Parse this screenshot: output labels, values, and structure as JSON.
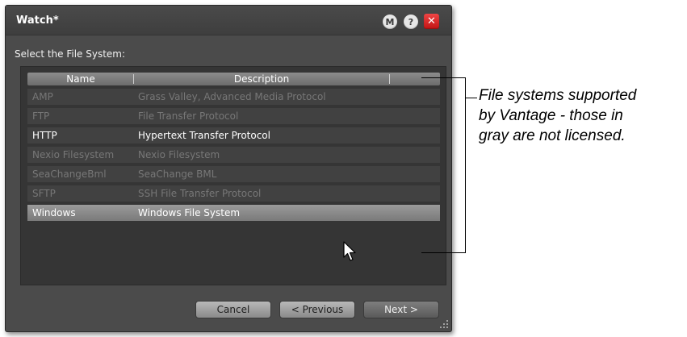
{
  "dialog": {
    "title": "Watch*",
    "buttons": {
      "m": "M",
      "help": "?",
      "close": "✕"
    },
    "prompt": "Select the File System:",
    "columns": {
      "name": "Name",
      "description": "Description"
    },
    "rows": [
      {
        "name": "AMP",
        "description": "Grass Valley, Advanced Media Protocol",
        "licensed": false
      },
      {
        "name": "FTP",
        "description": "File Transfer Protocol",
        "licensed": false
      },
      {
        "name": "HTTP",
        "description": "Hypertext Transfer Protocol",
        "licensed": true
      },
      {
        "name": "Nexio Filesystem",
        "description": "Nexio Filesystem",
        "licensed": false
      },
      {
        "name": "SeaChangeBml",
        "description": "SeaChange BML",
        "licensed": false
      },
      {
        "name": "SFTP",
        "description": "SSH File Transfer Protocol",
        "licensed": false
      },
      {
        "name": "Windows",
        "description": "Windows File System",
        "licensed": true,
        "selected": true
      }
    ],
    "footer": {
      "cancel": "Cancel",
      "previous": "< Previous",
      "next": "Next >"
    }
  },
  "annotation": {
    "lines": [
      "File systems supported",
      "by Vantage - those in",
      "gray are not licensed."
    ]
  }
}
